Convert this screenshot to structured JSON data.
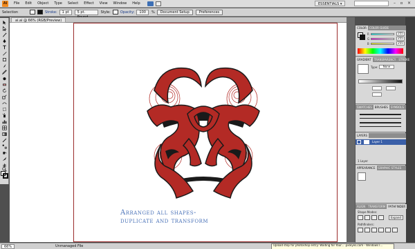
{
  "app": {
    "logo": "Ai"
  },
  "menubar": {
    "items": [
      "File",
      "Edit",
      "Object",
      "Type",
      "Select",
      "Effect",
      "View",
      "Window",
      "Help"
    ],
    "workspace": "ESSENTIALS ▾"
  },
  "controlbar": {
    "selection_label": "Selection",
    "stroke_label": "Stroke:",
    "stroke_weight": "1 pt",
    "brush": "5 pt. Round",
    "style_label": "Style:",
    "opacity_label": "Opacity:",
    "opacity_value": "100",
    "opacity_unit": "%",
    "document_setup": "Document Setup",
    "preferences": "Preferences"
  },
  "document": {
    "tab_title": "ai.ai @ 66% (RGB/Preview)",
    "caption_line1": "Arranged all shapes-",
    "caption_line2": "duplicate and transform"
  },
  "statusbar": {
    "zoom": "66%",
    "status": "Unmanaged File",
    "notice": "Upload step for photoshop entry: Waiting for Your... .pxleyes.com - Windows I..."
  },
  "panels": {
    "color": {
      "tabs": [
        "COLOR",
        "COLOR GUIDE"
      ],
      "r": "255",
      "g": "255",
      "b": "255"
    },
    "gradient": {
      "tabs": [
        "GRADIENT",
        "TRANSPARENCY",
        "STROKE"
      ],
      "type_label": "Type:",
      "type_value": "None"
    },
    "brushes": {
      "tabs": [
        "SWATCHES",
        "BRUSHES",
        "SYMBOLS"
      ]
    },
    "layers": {
      "tabs": [
        "LAYERS"
      ],
      "layer_name": "Layer 1",
      "footer": "1 Layer"
    },
    "appearance": {
      "tabs": [
        "APPEARANCE",
        "GRAPHIC STYLES"
      ]
    },
    "align": {
      "tabs": [
        "ALIGN",
        "TRANSFORM",
        "PATHFINDER"
      ],
      "shape_modes": "Shape Modes:",
      "expand": "Expand",
      "pathfinders": "Pathfinders:"
    }
  },
  "colors": {
    "artwork_red": "#b32a25",
    "artwork_outline": "#1a1a1a",
    "caption": "#4a72b8",
    "artboard_border": "#9a2a2a",
    "layer_highlight": "#3a5fa8"
  },
  "tools": [
    "selection-arrow",
    "direct-selection",
    "magic-wand",
    "lasso",
    "pen",
    "type",
    "line-segment",
    "rectangle",
    "paintbrush",
    "pencil",
    "blob-brush",
    "eraser",
    "rotate",
    "scale",
    "warp",
    "free-transform",
    "symbol-sprayer",
    "column-graph",
    "mesh",
    "gradient",
    "eyedropper",
    "blend",
    "live-paint",
    "slice",
    "scissors",
    "hand",
    "zoom"
  ]
}
